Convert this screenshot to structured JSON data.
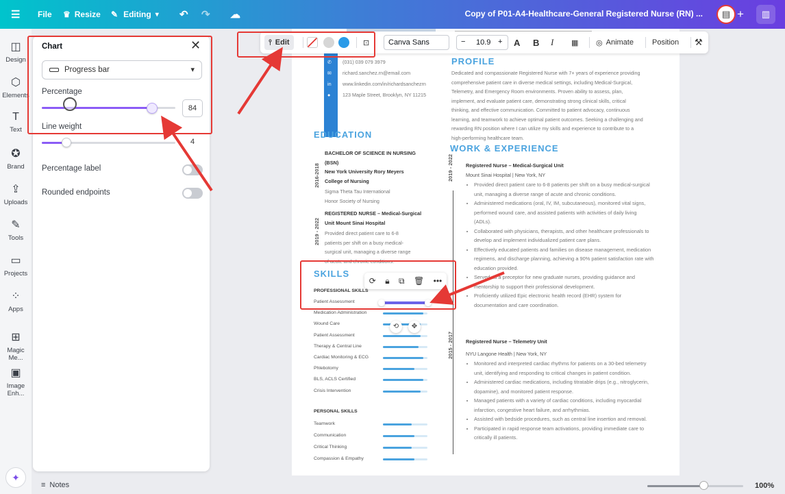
{
  "topbar": {
    "file_label": "File",
    "resize_label": "Resize",
    "editing_label": "Editing",
    "doc_title": "Copy of P01-A4-Healthcare-General Registered Nurse (RN) ..."
  },
  "rail": {
    "items": [
      {
        "label": "Design",
        "icon": "layout-icon"
      },
      {
        "label": "Elements",
        "icon": "shapes-icon"
      },
      {
        "label": "Text",
        "icon": "text-icon"
      },
      {
        "label": "Brand",
        "icon": "brand-icon"
      },
      {
        "label": "Uploads",
        "icon": "upload-icon"
      },
      {
        "label": "Tools",
        "icon": "pen-icon"
      },
      {
        "label": "Projects",
        "icon": "folder-icon"
      },
      {
        "label": "Apps",
        "icon": "apps-icon"
      },
      {
        "label": "Magic Me...",
        "icon": "magic-media-icon"
      },
      {
        "label": "Image Enh...",
        "icon": "image-enhancer-icon"
      }
    ]
  },
  "panel": {
    "title": "Chart",
    "chart_type": "Progress bar",
    "percentage_label": "Percentage",
    "percentage_value": "84",
    "line_weight_label": "Line weight",
    "line_weight_value": "4",
    "percentage_toggle_label": "Percentage label",
    "rounded_label": "Rounded endpoints",
    "percentage_toggle_on": false,
    "rounded_on": false
  },
  "toolbar": {
    "edit_label": "Edit",
    "font": "Canva Sans",
    "minus": "−",
    "size": "10.9",
    "plus": "+",
    "animate_label": "Animate",
    "position_label": "Position",
    "colors": [
      "#d6d6d6",
      "#2b9be8"
    ]
  },
  "resume": {
    "phone": "(031) 039 079 3979",
    "email": "richard.sanchez.rn@email.com",
    "linkedin": "www.linkedin.com/in/richardsanchezrn",
    "address": "123 Maple Street, Brooklyn, NY 11215",
    "profile_heading": "PROFILE",
    "profile_lines": [
      "Dedicated and compassionate Registered Nurse with 7+ years of experience providing",
      "comprehensive patient care in diverse medical settings, including Medical-Surgical,",
      "Telemetry, and Emergency Room environments. Proven ability to assess, plan,",
      "implement, and evaluate patient care, demonstrating strong clinical skills, critical",
      "thinking, and effective communication. Committed to patient advocacy, continuous",
      "learning, and teamwork to achieve optimal patient outcomes. Seeking a challenging and",
      "rewarding RN position where I can utilize my skills and experience to contribute to a",
      "high-performing healthcare team."
    ],
    "education_heading": "EDUCATION",
    "edu1_date": "2016-2018",
    "edu1_lines": [
      "BACHELOR OF SCIENCE IN NURSING",
      "(BSN)",
      "New York University Rory Meyers",
      "College of Nursing"
    ],
    "edu1_sub": [
      "Sigma Theta Tau International",
      "Honor Society of Nursing"
    ],
    "edu2_date": "2019 - 2022",
    "edu2_lines": [
      "REGISTERED NURSE – Medical-Surgical",
      "Unit Mount Sinai Hospital"
    ],
    "edu2_sub": [
      "Provided direct patient care to 6-8",
      "patients per shift on a busy medical-",
      "surgical unit, managing a diverse range",
      "of acute and chronic conditions."
    ],
    "work_heading": "WORK & EXPERIENCE",
    "job1_date": "2019 - 2022",
    "job1_title": "Registered Nurse – Medical-Surgical Unit",
    "job1_place": "Mount Sinai Hospital | New York, NY",
    "job1_bullets": [
      "Provided direct patient care to 6-8 patients per shift on a busy medical-surgical unit, managing a diverse range of acute and chronic conditions.",
      "Administered medications (oral, IV, IM, subcutaneous), monitored vital signs, performed wound care, and assisted patients with activities of daily living (ADLs).",
      "Collaborated with physicians, therapists, and other healthcare professionals to develop and implement individualized patient care plans.",
      "Effectively educated patients and families on disease management, medication regimens, and discharge planning, achieving a 90% patient satisfaction rate with education provided.",
      "Served as a preceptor for new graduate nurses, providing guidance and mentorship to support their professional development.",
      "Proficiently utilized Epic electronic health record (EHR) system for documentation and care coordination."
    ],
    "job2_date": "2015 - 2017",
    "job2_title": "Registered Nurse – Telemetry Unit",
    "job2_place": "NYU Langone Health | New York, NY",
    "job2_bullets": [
      "Monitored and interpreted cardiac rhythms for patients on a 30-bed telemetry unit, identifying and responding to critical changes in patient condition.",
      "Administered cardiac medications, including titratable drips (e.g., nitroglycerin, dopamine), and monitored patient response.",
      "Managed patients with a variety of cardiac conditions, including myocardial infarction, congestive heart failure, and arrhythmias.",
      "Assisted with bedside procedures, such as central line insertion and removal.",
      "Participated in rapid response team activations, providing immediate care to critically ill patients."
    ],
    "skills_heading": "SKILLS",
    "professional_heading": "PROFESSIONAL SKILLS",
    "professional_skills": [
      {
        "name": "Patient Assessment",
        "pct": 0.84
      },
      {
        "name": "Medication Administration",
        "pct": 0.9
      },
      {
        "name": "Wound Care",
        "pct": 0.85
      },
      {
        "name": "Patient Assessment",
        "pct": 0.85
      },
      {
        "name": "Therapy & Central Line",
        "pct": 0.8
      },
      {
        "name": "Cardiac Monitoring & ECG",
        "pct": 0.9
      },
      {
        "name": "Phlebotomy",
        "pct": 0.7
      },
      {
        "name": "BLS, ACLS Certified",
        "pct": 0.9
      },
      {
        "name": "Crisis Intervention",
        "pct": 0.85
      }
    ],
    "personal_heading": "PERSONAL SKILLS",
    "personal_skills": [
      {
        "name": "Teamwork",
        "pct": 0.65
      },
      {
        "name": "Communication",
        "pct": 0.7
      },
      {
        "name": "Critical Thinking",
        "pct": 0.65
      },
      {
        "name": "Compassion & Empathy",
        "pct": 0.7
      }
    ]
  },
  "bottom": {
    "notes_label": "Notes",
    "zoom_label": "100%"
  }
}
